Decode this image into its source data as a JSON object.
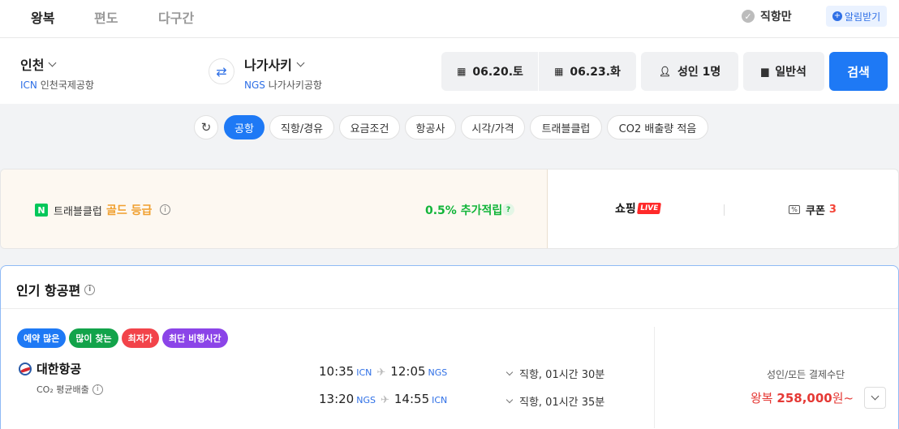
{
  "trip_tabs": [
    {
      "label": "왕복",
      "active": true
    },
    {
      "label": "편도",
      "active": false
    },
    {
      "label": "다구간",
      "active": false
    }
  ],
  "direct_only_label": "직항만",
  "alert_button_label": "알림받기",
  "origin": {
    "city": "인천",
    "code": "ICN",
    "airport": "인천국제공항"
  },
  "destination": {
    "city": "나가사키",
    "code": "NGS",
    "airport": "나가사키공항"
  },
  "dates": {
    "depart": "06.20.토",
    "return": "06.23.화"
  },
  "passengers_label": "성인 1명",
  "cabin_label": "일반석",
  "search_label": "검색",
  "filters": [
    "공항",
    "직항/경유",
    "요금조건",
    "항공사",
    "시각/가격",
    "트래블클럽",
    "CO2 배출량 적음"
  ],
  "active_filter": "공항",
  "promo": {
    "travel_club": "트래블클럽",
    "grade": "골드 등급",
    "accrual": "0.5% 추가적립",
    "accrual_hint": "?",
    "shopping": "쇼핑",
    "live": "LIVE",
    "coupon_label": "쿠폰",
    "coupon_count": "3"
  },
  "popular": {
    "title": "인기 항공편",
    "badges": [
      {
        "label": "예약 많은",
        "color": "#1e79f5"
      },
      {
        "label": "많이 찾는",
        "color": "#12a34a"
      },
      {
        "label": "최저가",
        "color": "#f2434a"
      },
      {
        "label": "최단 비행시간",
        "color": "#8b44e8"
      }
    ],
    "airline": "대한항공",
    "co2_label": "CO₂ 평균배출",
    "legs": [
      {
        "dep_time": "10:35",
        "dep_ap": "ICN",
        "arr_time": "12:05",
        "arr_ap": "NGS",
        "info": "직항, 01시간 30분"
      },
      {
        "dep_time": "13:20",
        "dep_ap": "NGS",
        "arr_time": "14:55",
        "arr_ap": "ICN",
        "info": "직항, 01시간 35분"
      }
    ],
    "price_label": "성인/모든 결제수단",
    "price_prefix": "왕복",
    "price_value": "258,000",
    "price_suffix": "원~"
  }
}
